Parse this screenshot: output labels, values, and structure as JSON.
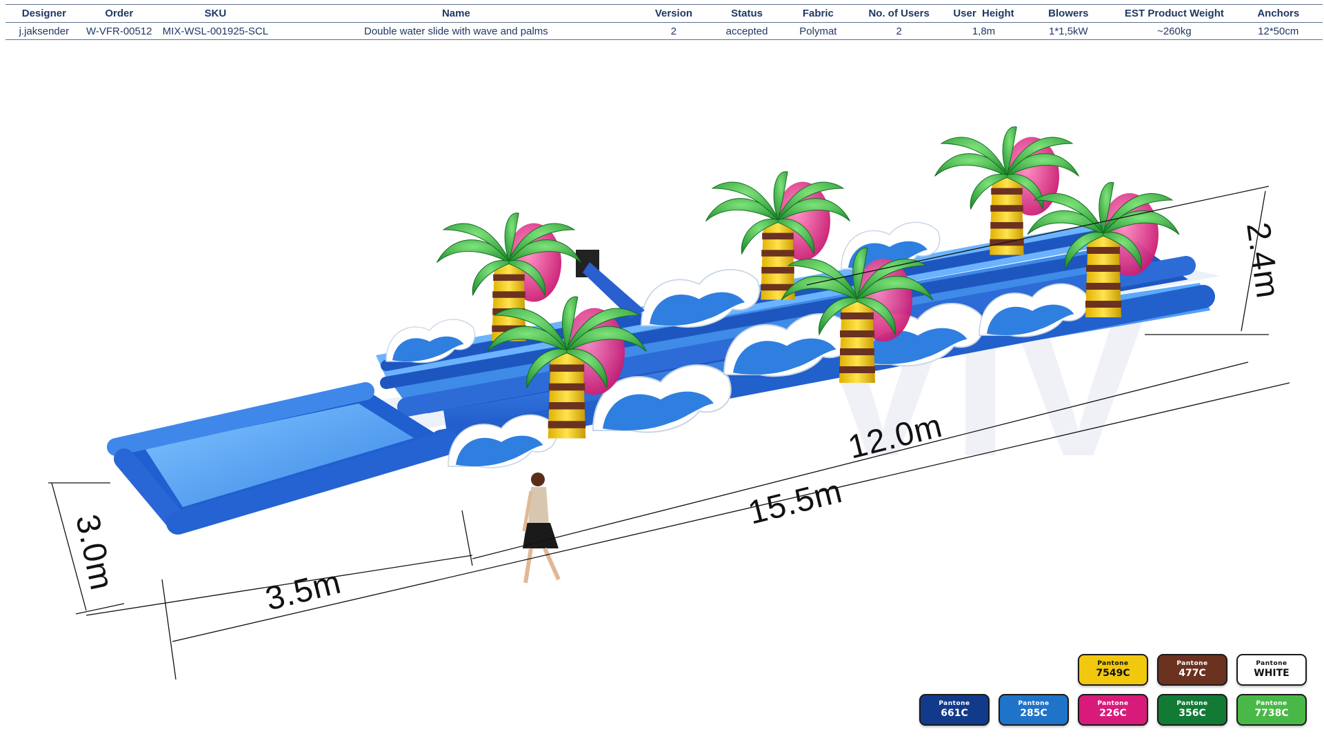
{
  "spec": {
    "headers": [
      "Designer",
      "Order",
      "SKU",
      "Name",
      "Version",
      "Status",
      "Fabric",
      "No. of Users",
      "User  Height",
      "Blowers",
      "EST Product Weight",
      "Anchors"
    ],
    "values": [
      "j.jaksender",
      "W-VFR-00512",
      "MIX-WSL-001925-SCL",
      "Double water slide with wave and palms",
      "2",
      "accepted",
      "Polymat",
      "2",
      "1,8m",
      "1*1,5kW",
      "~260kg",
      "12*50cm"
    ]
  },
  "dimensions": {
    "width": "3.0m",
    "pool_length": "3.5m",
    "total_length": "15.5m",
    "slide_length": "12.0m",
    "height": "2.4m"
  },
  "watermark": "VIV",
  "swatches": [
    {
      "pantone": "Pantone",
      "code": "7549C",
      "color": "#f2c80f"
    },
    {
      "pantone": "Pantone",
      "code": "477C",
      "color": "#6b3220"
    },
    {
      "pantone": "Pantone",
      "code": "WHITE",
      "color": "#ffffff"
    },
    {
      "pantone": "Pantone",
      "code": "661C",
      "color": "#123a8a"
    },
    {
      "pantone": "Pantone",
      "code": "285C",
      "color": "#1f73c9"
    },
    {
      "pantone": "Pantone",
      "code": "226C",
      "color": "#d81b7a"
    },
    {
      "pantone": "Pantone",
      "code": "356C",
      "color": "#137a36"
    },
    {
      "pantone": "Pantone",
      "code": "7738C",
      "color": "#4ab848"
    }
  ]
}
